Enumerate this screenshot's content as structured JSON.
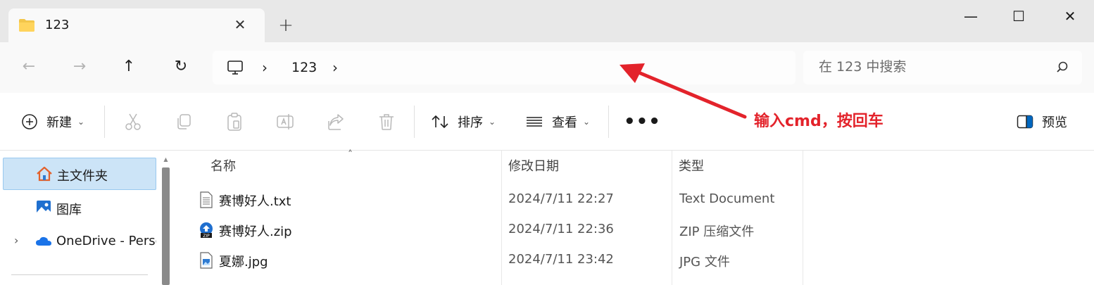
{
  "window": {
    "tab_title": "123",
    "tab_close_glyph": "✕",
    "new_tab_glyph": "+",
    "minimize_glyph": "—",
    "maximize_glyph": "☐",
    "close_glyph": "✕"
  },
  "nav": {
    "back_glyph": "←",
    "forward_glyph": "→",
    "up_glyph": "↑",
    "refresh_glyph": "↻",
    "breadcrumb": [
      "123"
    ],
    "chevron": "›",
    "search_placeholder": "在 123 中搜索"
  },
  "toolbar": {
    "new_label": "新建",
    "sort_label": "排序",
    "view_label": "查看",
    "more_label": "•••",
    "preview_label": "预览",
    "dropdown_glyph": "⌄",
    "icons": [
      "cut-icon",
      "copy-icon",
      "paste-icon",
      "rename-icon",
      "share-icon",
      "delete-icon"
    ]
  },
  "annotation": {
    "text": "输入cmd，按回车",
    "color": "#e3232b"
  },
  "sidebar": {
    "items": [
      {
        "label": "主文件夹",
        "icon": "home-icon",
        "selected": true
      },
      {
        "label": "图库",
        "icon": "gallery-icon",
        "selected": false
      },
      {
        "label": "OneDrive - Personal",
        "icon": "onedrive-icon",
        "selected": false
      }
    ],
    "expand_glyph": "›",
    "scroll_up_glyph": "▲"
  },
  "filelist": {
    "sort_glyph": "˄",
    "columns": [
      "名称",
      "修改日期",
      "类型"
    ],
    "rows": [
      {
        "name": "赛博好人.txt",
        "date": "2024/7/11 22:27",
        "type": "Text Document",
        "icon": "text-file-icon"
      },
      {
        "name": "赛博好人.zip",
        "date": "2024/7/11 22:36",
        "type": "ZIP 压缩文件",
        "icon": "zip-file-icon"
      },
      {
        "name": "夏娜.jpg",
        "date": "2024/7/11 23:42",
        "type": "JPG 文件",
        "icon": "image-file-icon"
      }
    ]
  },
  "colors": {
    "accent": "#0067c0",
    "selection": "#cce4f7",
    "annotation_red": "#e3232b"
  }
}
